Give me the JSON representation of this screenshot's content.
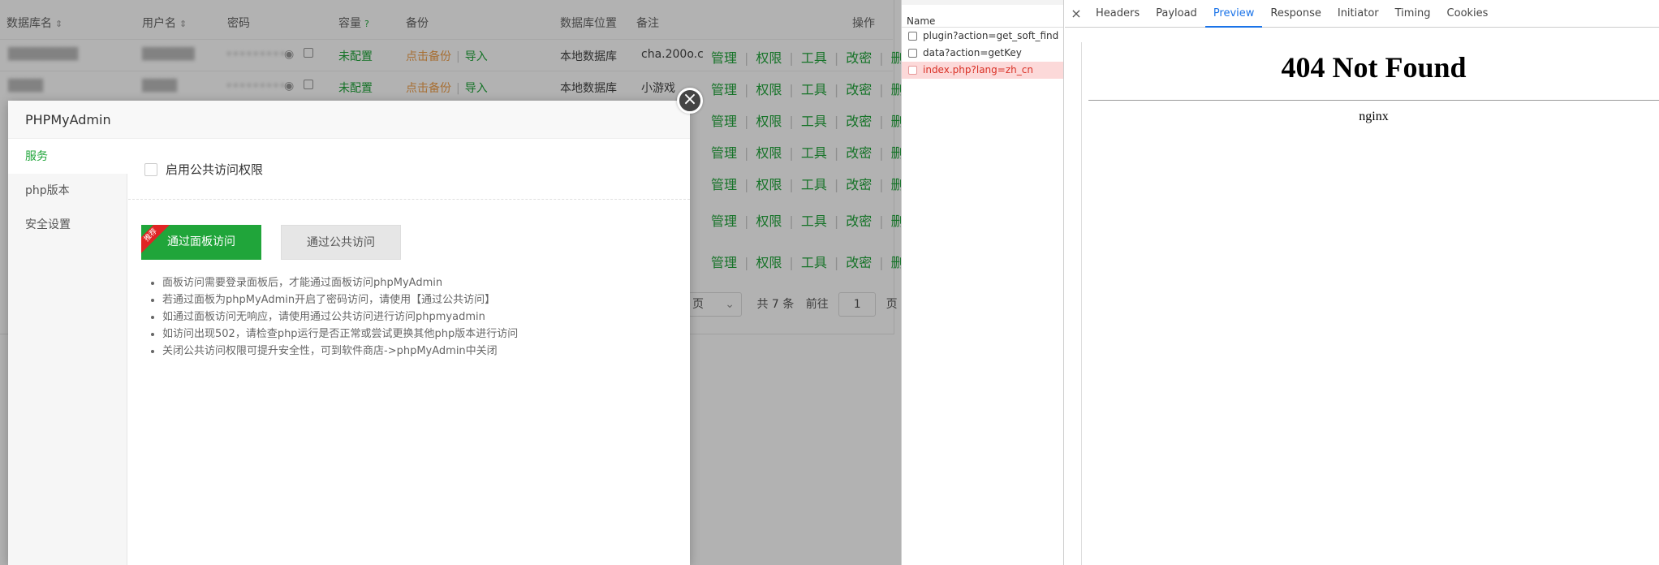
{
  "table": {
    "headers": {
      "name": "数据库名",
      "user": "用户名",
      "password": "密码",
      "capacity": "容量",
      "backup": "备份",
      "location": "数据库位置",
      "remark": "备注",
      "ops": "操作"
    },
    "rows": [
      {
        "name": "████████",
        "user": "██████",
        "password": "•••••••••",
        "capacity": "未配置",
        "backup_action": "点击备份",
        "import": "导入",
        "location": "本地数据库",
        "remark": "cha.200o.c"
      },
      {
        "name": "████",
        "user": "████",
        "password": "•••••••••",
        "capacity": "未配置",
        "backup_action": "点击备份",
        "import": "导入",
        "location": "本地数据库",
        "remark": "小游戏"
      }
    ],
    "ops": {
      "manage": "管理",
      "perm": "权限",
      "tools": "工具",
      "chpwd": "改密",
      "delete": "删除"
    },
    "pager": {
      "per_page_suffix": "页",
      "total": "共 7 条",
      "goto": "前往",
      "page": "1",
      "page_suffix": "页"
    }
  },
  "modal": {
    "title": "PHPMyAdmin",
    "close_glyph": "×",
    "side": [
      "服务",
      "php版本",
      "安全设置"
    ],
    "public_access_label": "启用公共访问权限",
    "panel_button": "通过面板访问",
    "recommend": "推荐",
    "public_button": "通过公共访问",
    "tips": [
      "面板访问需要登录面板后，才能通过面板访问phpMyAdmin",
      "若通过面板为phpMyAdmin开启了密码访问，请使用【通过公共访问】",
      "如通过面板访问无响应，请使用通过公共访问进行访问phpmyadmin",
      "如访问出现502，请检查php运行是否正常或尝试更换其他php版本进行访问",
      "关闭公共访问权限可提升安全性，可到软件商店->phpMyAdmin中关闭"
    ]
  },
  "devtools": {
    "name_header": "Name",
    "requests": [
      {
        "name": "plugin?action=get_soft_find",
        "error": false
      },
      {
        "name": "data?action=getKey",
        "error": false
      },
      {
        "name": "index.php?lang=zh_cn",
        "error": true
      }
    ],
    "close_glyph": "×",
    "tabs": [
      "Headers",
      "Payload",
      "Preview",
      "Response",
      "Initiator",
      "Timing",
      "Cookies"
    ],
    "active_tab": "Preview",
    "preview": {
      "title": "404 Not Found",
      "server": "nginx"
    }
  },
  "colors": {
    "accent": "#20a53a",
    "link_orange": "#f0a04b",
    "error_red": "#d93025",
    "devtools_blue": "#1a73e8"
  }
}
